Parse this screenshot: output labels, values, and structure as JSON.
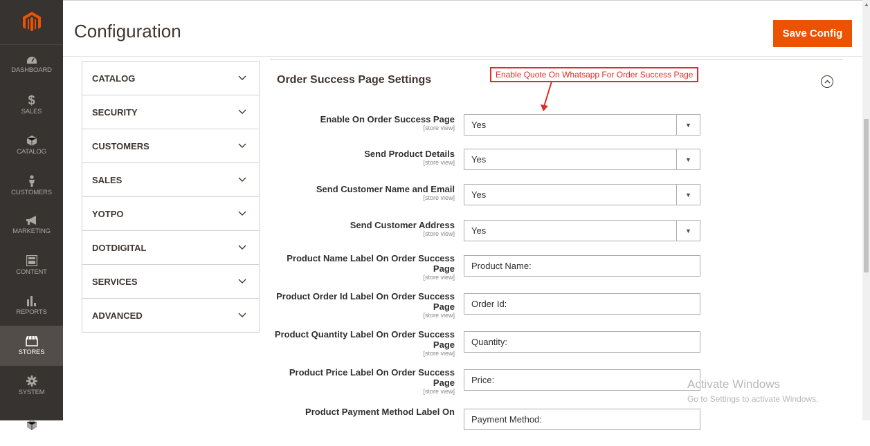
{
  "nav": {
    "items": [
      {
        "label": "DASHBOARD",
        "icon": "dashboard-icon"
      },
      {
        "label": "SALES",
        "icon": "dollar-icon"
      },
      {
        "label": "CATALOG",
        "icon": "cube-icon"
      },
      {
        "label": "CUSTOMERS",
        "icon": "person-icon"
      },
      {
        "label": "MARKETING",
        "icon": "megaphone-icon"
      },
      {
        "label": "CONTENT",
        "icon": "layout-icon"
      },
      {
        "label": "REPORTS",
        "icon": "bar-chart-icon"
      },
      {
        "label": "STORES",
        "icon": "storefront-icon"
      },
      {
        "label": "SYSTEM",
        "icon": "gear-icon"
      },
      {
        "label": "",
        "icon": "cube-icon"
      }
    ]
  },
  "header": {
    "title": "Configuration",
    "save_label": "Save Config"
  },
  "tabs": [
    "CATALOG",
    "SECURITY",
    "CUSTOMERS",
    "SALES",
    "YOTPO",
    "DOTDIGITAL",
    "SERVICES",
    "ADVANCED"
  ],
  "section": {
    "title": "Order Success Page Settings",
    "annotation": "Enable Quote On Whatsapp For Order Success Page"
  },
  "fields": [
    {
      "label": "Enable On Order Success Page",
      "scope": "[store view]",
      "value": "Yes"
    },
    {
      "label": "Send Product Details",
      "scope": "[store view]",
      "value": "Yes"
    },
    {
      "label": "Send Customer Name and Email",
      "scope": "[store view]",
      "value": "Yes"
    },
    {
      "label": "Send Customer Address",
      "scope": "[store view]",
      "value": "Yes"
    },
    {
      "label": "Product Name Label On Order Success Page",
      "scope": "[store view]",
      "value": "Product Name:"
    },
    {
      "label": "Product Order Id Label On Order Success Page",
      "scope": "[store view]",
      "value": "Order Id:"
    },
    {
      "label": "Product Quantity Label On Order Success Page",
      "scope": "[store view]",
      "value": "Quantity:"
    },
    {
      "label": "Product Price Label On Order Success Page",
      "scope": "[store view]",
      "value": "Price:"
    },
    {
      "label": "Product Payment Method Label On",
      "scope": "",
      "value": "Payment Method:"
    }
  ],
  "watermark": {
    "line1": "Activate Windows",
    "line2": "Go to Settings to activate Windows."
  },
  "colors": {
    "accent": "#eb5202",
    "nav_bg": "#373330",
    "annotation": "#e02b27"
  }
}
